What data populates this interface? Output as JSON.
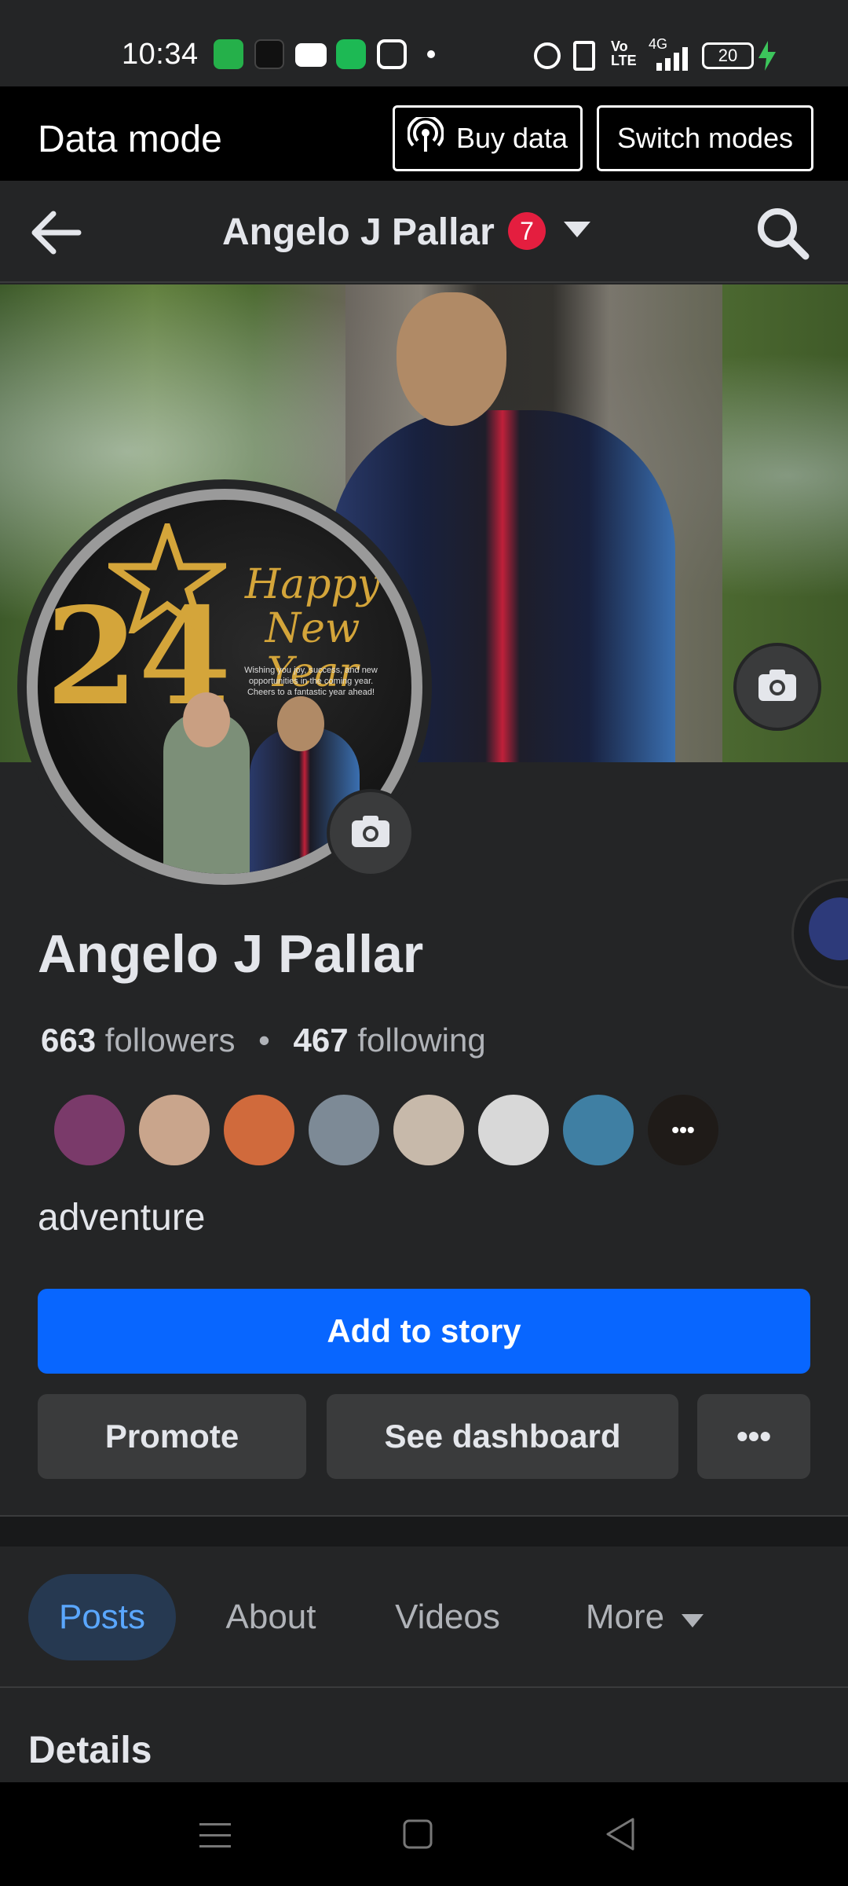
{
  "status_bar": {
    "time": "10:34",
    "battery": "20",
    "network": "4G"
  },
  "data_mode_bar": {
    "title": "Data mode",
    "buy_data_label": "Buy data",
    "switch_modes_label": "Switch modes"
  },
  "nav": {
    "title": "Angelo J Pallar",
    "notification_count": "7"
  },
  "profile": {
    "name": "Angelo J Pallar",
    "followers_count": "663",
    "followers_label": "followers",
    "separator": "•",
    "following_count": "467",
    "following_label": "following",
    "bio": "adventure",
    "avatar_text": {
      "year": "24",
      "greeting_line1": "Happy",
      "greeting_line2": "New Year",
      "message": "Wishing you joy, success, and new opportunities in the coming year. Cheers to a fantastic year ahead!"
    },
    "friend_avatar_colors": [
      "#7a3a6a",
      "#c9a58c",
      "#d06a3c",
      "#7d8a96",
      "#c7b9aa",
      "#d8d8d8",
      "#3f7fa3",
      "#1f1b18"
    ],
    "friends_more_label": "•••"
  },
  "actions": {
    "add_to_story": "Add to story",
    "promote": "Promote",
    "see_dashboard": "See dashboard",
    "more": "•••"
  },
  "tabs": [
    {
      "label": "Posts",
      "active": true
    },
    {
      "label": "About",
      "active": false
    },
    {
      "label": "Videos",
      "active": false
    },
    {
      "label": "More",
      "active": false
    }
  ],
  "section_title": "Details",
  "colors": {
    "primary": "#0866ff",
    "background": "#242526",
    "active_tab_bg": "#263951",
    "active_tab_text": "#5aa7ff",
    "badge": "#e41e3f"
  }
}
